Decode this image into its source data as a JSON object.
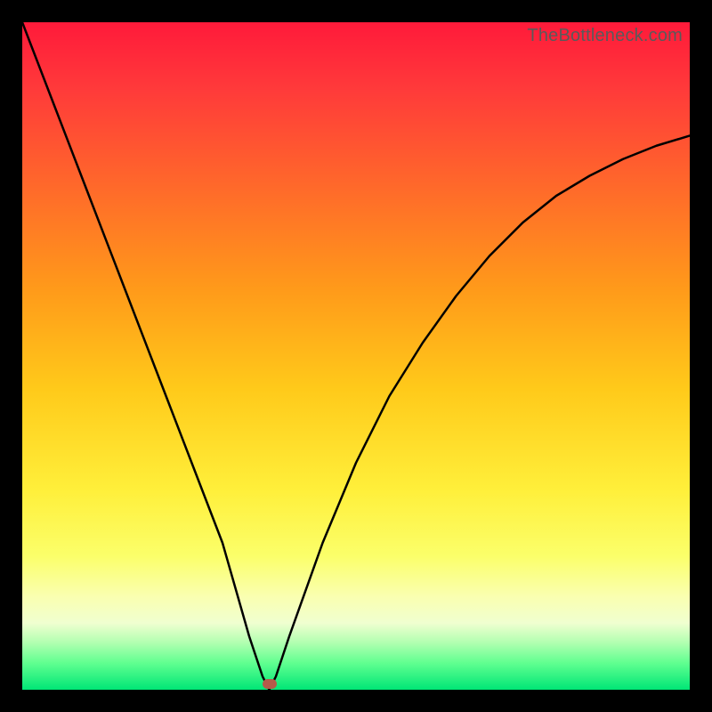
{
  "watermark": "TheBottleneck.com",
  "chart_data": {
    "type": "line",
    "title": "",
    "xlabel": "",
    "ylabel": "",
    "xlim": [
      0,
      100
    ],
    "ylim": [
      0,
      100
    ],
    "grid": false,
    "legend": false,
    "marker": {
      "x": 37,
      "y": 1,
      "color": "#b55a4a"
    },
    "series": [
      {
        "name": "bottleneck-curve",
        "x": [
          0,
          5,
          10,
          15,
          20,
          25,
          30,
          34,
          36,
          37,
          38,
          40,
          45,
          50,
          55,
          60,
          65,
          70,
          75,
          80,
          85,
          90,
          95,
          100
        ],
        "values": [
          100,
          87,
          74,
          61,
          48,
          35,
          22,
          8,
          2,
          0,
          2,
          8,
          22,
          34,
          44,
          52,
          59,
          65,
          70,
          74,
          77,
          79.5,
          81.5,
          83
        ]
      }
    ],
    "background_gradient": {
      "direction": "vertical",
      "stops": [
        {
          "pos": 0,
          "color": "#ff1a3a"
        },
        {
          "pos": 25,
          "color": "#ff6a2a"
        },
        {
          "pos": 55,
          "color": "#ffca1a"
        },
        {
          "pos": 80,
          "color": "#fbff6a"
        },
        {
          "pos": 93,
          "color": "#b0ffb0"
        },
        {
          "pos": 100,
          "color": "#00e676"
        }
      ]
    }
  }
}
